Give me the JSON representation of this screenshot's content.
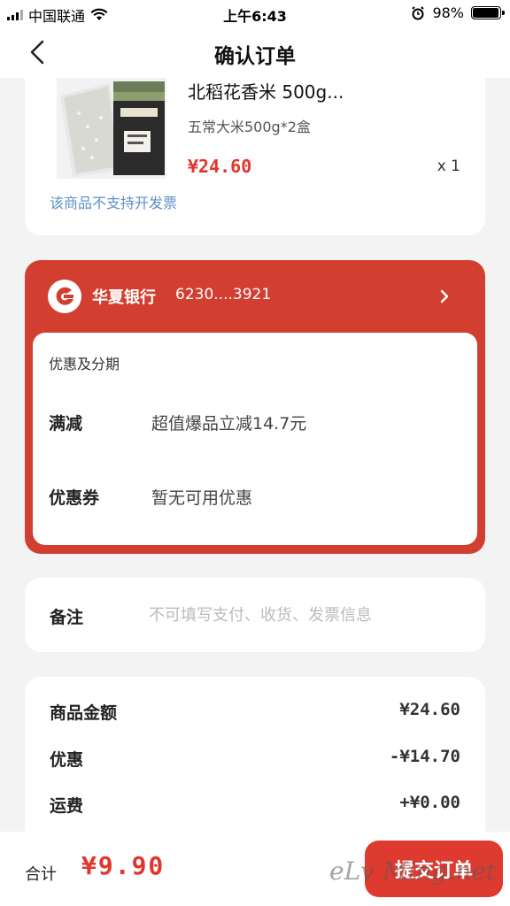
{
  "status_bar": {
    "carrier": "中国联通",
    "time": "上午6:43",
    "battery": "98%",
    "battery_level": 0.98
  },
  "nav": {
    "title": "确认订单",
    "back_icon": "chevron-left-icon"
  },
  "product": {
    "title": "北稻花香米 500g...",
    "spec": "五常大米500g*2盒",
    "price": "¥24.60",
    "quantity": "x 1",
    "invoice_note": "该商品不支持开发票"
  },
  "payment": {
    "bank_name": "华夏银行",
    "card_number": "6230....3921",
    "promo_header": "优惠及分期",
    "rows": [
      {
        "label": "满减",
        "value": "超值爆品立减14.7元"
      },
      {
        "label": "优惠券",
        "value": "暂无可用优惠"
      }
    ],
    "colors": {
      "card": "#d23f31"
    }
  },
  "remark": {
    "label": "备注",
    "placeholder": "不可填写支付、收货、发票信息"
  },
  "summary": {
    "rows": [
      {
        "label": "商品金额",
        "value": "¥24.60"
      },
      {
        "label": "优惠",
        "value": "-¥14.70"
      },
      {
        "label": "运费",
        "value": "+¥0.00"
      }
    ]
  },
  "bottom": {
    "total_label": "合计",
    "total_value": "¥9.90",
    "submit_label": "提交订单",
    "watermark": "eLv Ming.net"
  },
  "colors": {
    "accent": "#e0362c",
    "link": "#5b8fc6"
  }
}
